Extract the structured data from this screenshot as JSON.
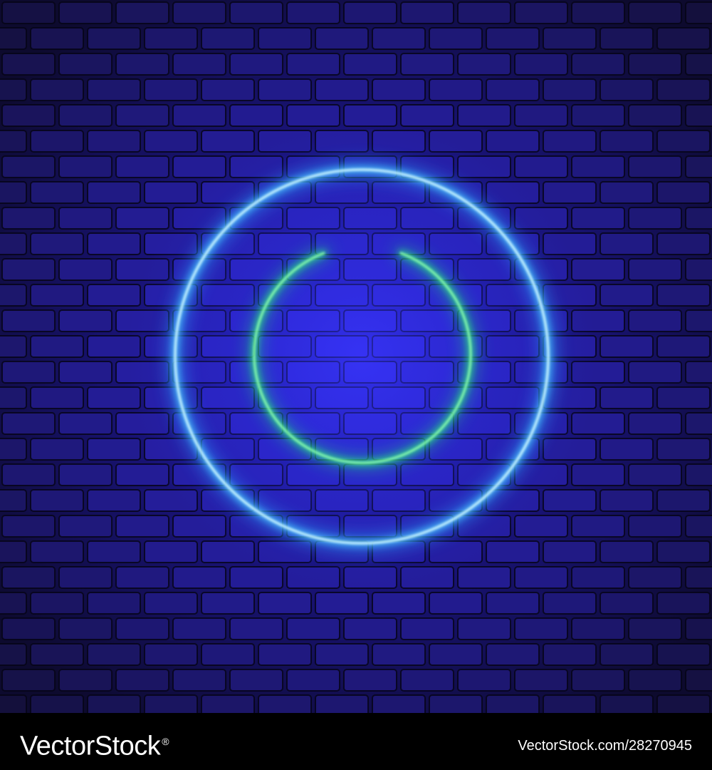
{
  "scene": {
    "subject": "power-icon",
    "colors": {
      "wall_dark": "#0d0a2e",
      "wall_mid": "#1a1480",
      "wall_center": "#2a22d6",
      "mortar": "#07061c",
      "ring_glow": "#2aa8ff",
      "ring_core": "#c8f4ff",
      "symbol_glow": "#1fe07a",
      "symbol_core": "#8dffb0"
    }
  },
  "footer": {
    "brand_text": "VectorStock",
    "brand_mark": "®",
    "image_id": "VectorStock.com/28270945"
  }
}
